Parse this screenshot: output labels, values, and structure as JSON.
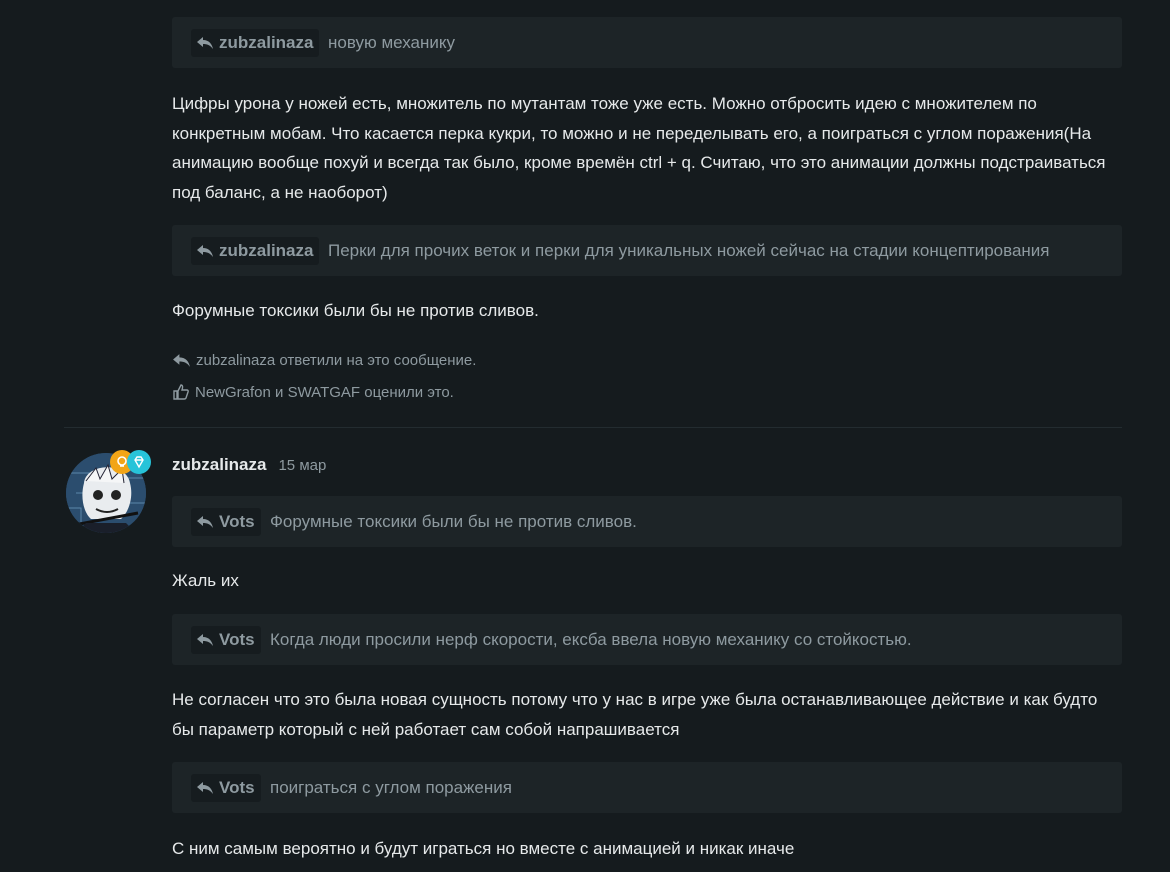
{
  "post1": {
    "quote1": {
      "author": "zubzalinaza",
      "text": "новую механику"
    },
    "paragraph1": "Цифры урона у ножей есть, множитель по мутантам тоже уже есть. Можно отбросить идею с множителем по конкретным мобам. Что касается перка кукри, то можно и не переделывать его, а поиграться с углом поражения(На анимацию вообще похуй и всегда так было, кроме времён ctrl + q. Считаю, что это анимации должны подстраиваться под баланс, а не наоборот)",
    "quote2": {
      "author": "zubzalinaza",
      "text": "Перки для прочих веток и перки для уникальных ножей сейчас на стадии концептирования"
    },
    "paragraph2": "Форумные токсики были бы не против сливов.",
    "replies_line": "zubzalinaza ответили на это сообщение.",
    "likes_line": "NewGrafon и SWATGAF оценили это."
  },
  "post2": {
    "author": "zubzalinaza",
    "date": "15 мар",
    "quote1": {
      "author": "Vots",
      "text": "Форумные токсики были бы не против сливов."
    },
    "paragraph1": "Жаль их",
    "quote2": {
      "author": "Vots",
      "text": "Когда люди просили нерф скорости, ексба ввела новую механику со стойкостью."
    },
    "paragraph2": "Не согласен что это была новая сущность потому что у нас в игре уже была останавливающее действие и как будто бы параметр который с ней работает сам собой напрашивается",
    "quote3": {
      "author": "Vots",
      "text": "поиграться с углом поражения"
    },
    "paragraph3": "С ним самым вероятно и будут играться но вместе с анимацией и никак иначе",
    "badges": [
      "bulb-badge-icon",
      "diamond-badge-icon"
    ]
  },
  "colors": {
    "background": "#151b1e",
    "quote_bg": "#1d2427",
    "text": "#e6e9ea",
    "muted": "#8e9aa0",
    "badge_gold": "#f2a517",
    "badge_cyan": "#27c3d9"
  }
}
